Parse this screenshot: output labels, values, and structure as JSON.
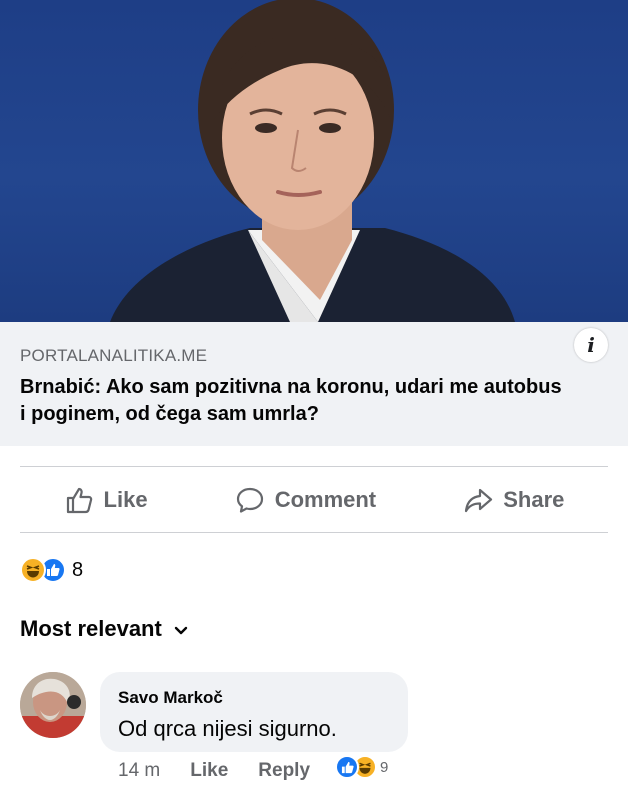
{
  "post": {
    "link": {
      "domain": "PORTALANALITIKA.ME",
      "headline": "Brnabić: Ako sam pozitivna na koronu, udari me autobus i poginem, od čega sam umrla?"
    }
  },
  "actions": {
    "like_label": "Like",
    "comment_label": "Comment",
    "share_label": "Share"
  },
  "reactions": {
    "icons": [
      "haha",
      "like"
    ],
    "count": "8"
  },
  "comments_sort": {
    "label": "Most relevant"
  },
  "comments": [
    {
      "author": "Savo Markoč",
      "text": "Od qrca nijesi sigurno.",
      "time": "14 m",
      "like_label": "Like",
      "reply_label": "Reply",
      "reaction_icons": [
        "like",
        "haha"
      ],
      "reaction_count": "9"
    }
  ],
  "colors": {
    "accent": "#1877f2",
    "haha": "#f7b125",
    "secondary_text": "#65676b",
    "photo_background": "#23468f"
  }
}
